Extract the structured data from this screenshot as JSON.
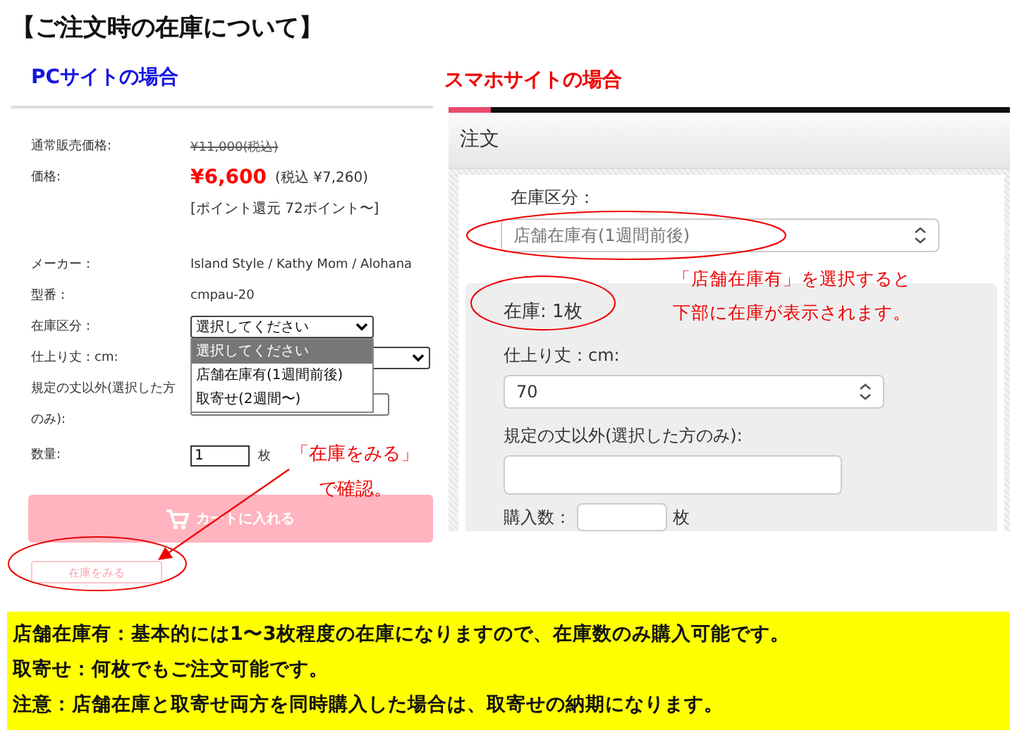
{
  "title": "【ご注文時の在庫について】",
  "pc": {
    "heading": "PCサイトの場合",
    "fields": [
      {
        "kind": "strike",
        "label": "通常販売価格:",
        "value": "¥11,000(税込)"
      },
      {
        "kind": "price",
        "label": "価格:",
        "price": "¥6,600",
        "tax": "(税込 ¥7,260)",
        "points": "[ポイント還元 72ポイント〜]"
      },
      {
        "kind": "text",
        "label": "メーカー：",
        "value": "Island Style / Kathy Mom / Alohana"
      },
      {
        "kind": "text",
        "label": "型番：",
        "value": "cmpau-20"
      },
      {
        "kind": "select",
        "label": "在庫区分：",
        "value": "選択してください",
        "expanded": true,
        "options": [
          {
            "label": "選択してください",
            "selected": true
          },
          {
            "label": "店舗在庫有(1週間前後)",
            "selected": false
          },
          {
            "label": "取寄せ(2週間〜)",
            "selected": false
          }
        ]
      },
      {
        "kind": "select",
        "label": "仕上り丈：cm:",
        "expanded": false
      },
      {
        "kind": "input",
        "label": "規定の丈以外(選択した方のみ):"
      },
      {
        "kind": "quantity",
        "label": "数量:",
        "value": "1",
        "unit": "枚"
      }
    ],
    "cart_button": "カートに入れる",
    "stock_button": "在庫をみる",
    "note": [
      "「在庫をみる」",
      "で確認。"
    ]
  },
  "sp": {
    "heading": "スマホサイトの場合",
    "header": "注文",
    "stock_label": "在庫区分：",
    "stock_value": "店舗在庫有(1週間前後)",
    "stock_count": "在庫: 1枚",
    "length_label": "仕上り丈：cm:",
    "length_value": "70",
    "custom_label": "規定の丈以外(選択した方のみ):",
    "qty_label": "購入数：",
    "qty_unit": "枚",
    "note": [
      "「店舗在庫有」を選択すると",
      "下部に在庫が表示されます。"
    ]
  },
  "notes": [
    "店舗在庫有：基本的には1〜3枚程度の在庫になりますので、在庫数のみ購入可能です。",
    "取寄せ：何枚でもご注文可能です。",
    "注意：店舗在庫と取寄せ両方を同時購入した場合は、取寄せの納期になります。"
  ]
}
